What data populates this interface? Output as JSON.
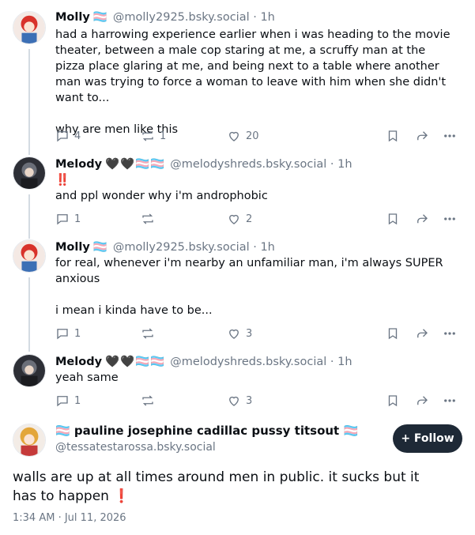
{
  "posts": [
    {
      "author": "Molly",
      "flags": "🏳️‍⚧️",
      "handle": "@molly2925.bsky.social",
      "time": "1h",
      "text": "had a harrowing experience earlier when i was heading to the movie theater, between a male cop staring at me, a scruffy man at the pizza place glaring at me, and being next to a table where another man was trying to force a woman to leave with him when she didn't want to...\n\nwhy are men like this",
      "replies": "4",
      "reposts": "1",
      "likes": "20"
    },
    {
      "author": "Melody",
      "flags": "🖤🖤🏳️‍⚧️🏳️‍⚧️",
      "handle": "@melodyshreds.bsky.social",
      "time": "1h",
      "text": "‼️\nand ppl wonder why i'm androphobic",
      "replies": "1",
      "reposts": "",
      "likes": "2"
    },
    {
      "author": "Molly",
      "flags": "🏳️‍⚧️",
      "handle": "@molly2925.bsky.social",
      "time": "1h",
      "text": "for real, whenever i'm nearby an unfamiliar man, i'm always SUPER anxious\n\ni mean i kinda have to be...",
      "replies": "1",
      "reposts": "",
      "likes": "3"
    },
    {
      "author": "Melody",
      "flags": "🖤🖤🏳️‍⚧️🏳️‍⚧️",
      "handle": "@melodyshreds.bsky.social",
      "time": "1h",
      "text": "yeah same",
      "replies": "1",
      "reposts": "",
      "likes": "3"
    }
  ],
  "main": {
    "name": "🏳️‍⚧️ pauline josephine cadillac pussy titsout 🏳️‍⚧️",
    "handle": "@tessatestarossa.bsky.social",
    "follow_label": "+ Follow",
    "text": "walls are up at all times around men in public. it sucks but it has to happen ❗",
    "timestamp": "1:34 AM · Jul 11, 2026"
  },
  "icons": [
    "reply-icon",
    "repost-icon",
    "like-icon",
    "bookmark-icon",
    "share-icon",
    "more-icon"
  ]
}
